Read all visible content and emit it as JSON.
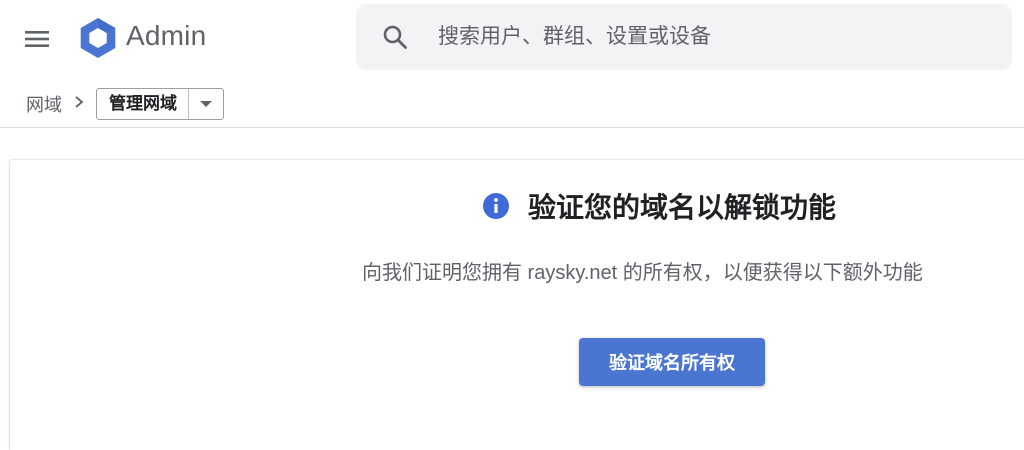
{
  "header": {
    "menu_icon": "hamburger-menu-icon",
    "logo_icon": "admin-hexagon-logo",
    "app_title": "Admin",
    "search": {
      "icon": "search-icon",
      "placeholder": "搜索用户、群组、设置或设备",
      "value": ""
    }
  },
  "breadcrumb": {
    "root": "网域",
    "separator_icon": "chevron-right-icon",
    "current": "管理网域",
    "dropdown_icon": "caret-down-icon"
  },
  "card": {
    "icon": "info-icon",
    "title": "验证您的域名以解锁功能",
    "subtitle": "向我们证明您拥有 raysky.net 的所有权，以便获得以下额外功能",
    "button_label": "验证域名所有权"
  },
  "colors": {
    "accent": "#4a76d2",
    "logo_blue": "#4a76d2",
    "info_blue": "#3f6ad8",
    "search_bg": "#f1f3f4",
    "muted_text": "#5f6368"
  }
}
